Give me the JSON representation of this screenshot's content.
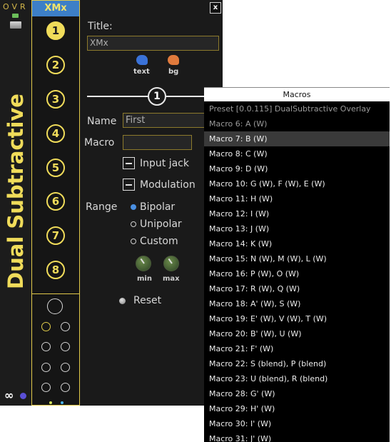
{
  "module": {
    "brand": "OVR",
    "title": "Dual Subtractive",
    "footer_icon": "infinity-icon",
    "colors": {
      "accent_yellow": "#f0dc5a",
      "header_blue": "#3d7fc7",
      "panel_bg": "#1a1a1a"
    }
  },
  "xmx": {
    "header": "XMx",
    "macros": [
      "1",
      "2",
      "3",
      "4",
      "5",
      "6",
      "7",
      "8"
    ],
    "selected_index": 0
  },
  "settings": {
    "close_label": "x",
    "title_label": "Title:",
    "title_value": "XMx",
    "text_color_label": "text",
    "bg_color_label": "bg",
    "text_color": "#3a72d8",
    "bg_color": "#e07a3c",
    "current_macro": "1",
    "name_label": "Name",
    "name_value": "First",
    "macro_label": "Macro",
    "macro_value": "",
    "input_jack_label": "Input jack",
    "modulation_label": "Modulation",
    "range_label": "Range",
    "range_options": [
      "Bipolar",
      "Unipolar",
      "Custom"
    ],
    "range_selected": "Bipolar",
    "min_label": "min",
    "max_label": "max",
    "reset_label": "Reset"
  },
  "menu": {
    "title": "Macros",
    "items": [
      "Preset [0.0.115] DualSubtractive Overlay",
      "Macro 6: A (W)",
      "Macro 7: B (W)",
      "Macro 8: C (W)",
      "Macro 9: D (W)",
      "Macro 10: G (W), F (W), E (W)",
      "Macro 11: H (W)",
      "Macro 12: I (W)",
      "Macro 13: J (W)",
      "Macro 14: K (W)",
      "Macro 15: N (W), M (W), L (W)",
      "Macro 16: P (W), O (W)",
      "Macro 17: R (W), Q (W)",
      "Macro 18: A' (W), S (W)",
      "Macro 19: E' (W), V (W), T (W)",
      "Macro 20: B' (W), U (W)",
      "Macro 21: F' (W)",
      "Macro 22: S (blend), P (blend)",
      "Macro 23: U (blend), R (blend)",
      "Macro 28: G' (W)",
      "Macro 29: H' (W)",
      "Macro 30: I' (W)",
      "Macro 31: J' (W)"
    ],
    "dim_indices": [
      0,
      1
    ],
    "highlight_index": 2
  }
}
